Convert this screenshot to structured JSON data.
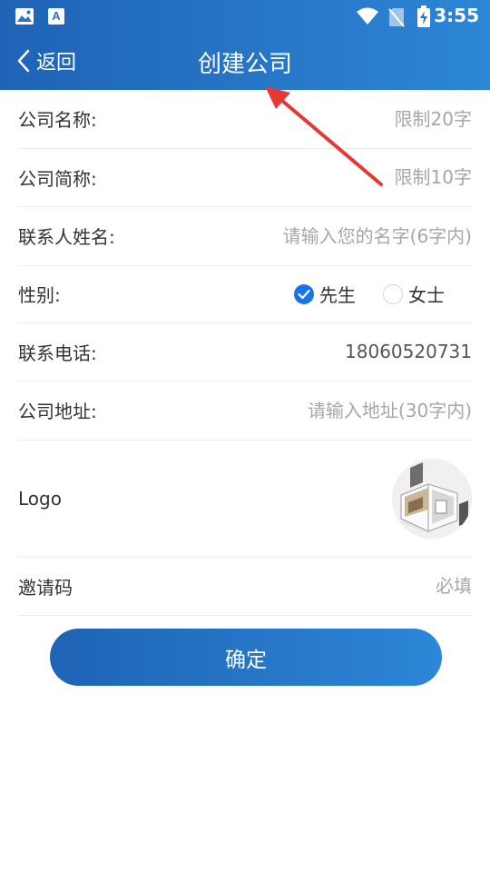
{
  "status_bar": {
    "time": "3:55",
    "left_icons": [
      "image-icon",
      "text-a-icon"
    ],
    "right_icons": [
      "wifi-icon",
      "no-sim-icon",
      "battery-charging-icon"
    ]
  },
  "header": {
    "back_label": "返回",
    "title": "创建公司",
    "gradient_colors": [
      "#1f63b5",
      "#2d86d6"
    ]
  },
  "form": {
    "company_name": {
      "label": "公司名称:",
      "value": "",
      "placeholder": "限制20字"
    },
    "company_short": {
      "label": "公司简称:",
      "value": "",
      "placeholder": "限制10字"
    },
    "contact_name": {
      "label": "联系人姓名:",
      "value": "",
      "placeholder": "请输入您的名字(6字内)"
    },
    "gender": {
      "label": "性别:",
      "options": [
        {
          "label": "先生",
          "selected": true
        },
        {
          "label": "女士",
          "selected": false
        }
      ]
    },
    "phone": {
      "label": "联系电话:",
      "value": "18060520731",
      "placeholder": ""
    },
    "address": {
      "label": "公司地址:",
      "value": "",
      "placeholder": "请输入地址(30字内)"
    },
    "logo": {
      "label": "Logo",
      "image": "house-3d-model-thumbnail"
    },
    "invite_code": {
      "label": "邀请码",
      "value": "",
      "placeholder": "必填"
    }
  },
  "confirm_label": "确定",
  "colors": {
    "accent": "#1a73e8",
    "annotation_arrow": "#e53935"
  }
}
